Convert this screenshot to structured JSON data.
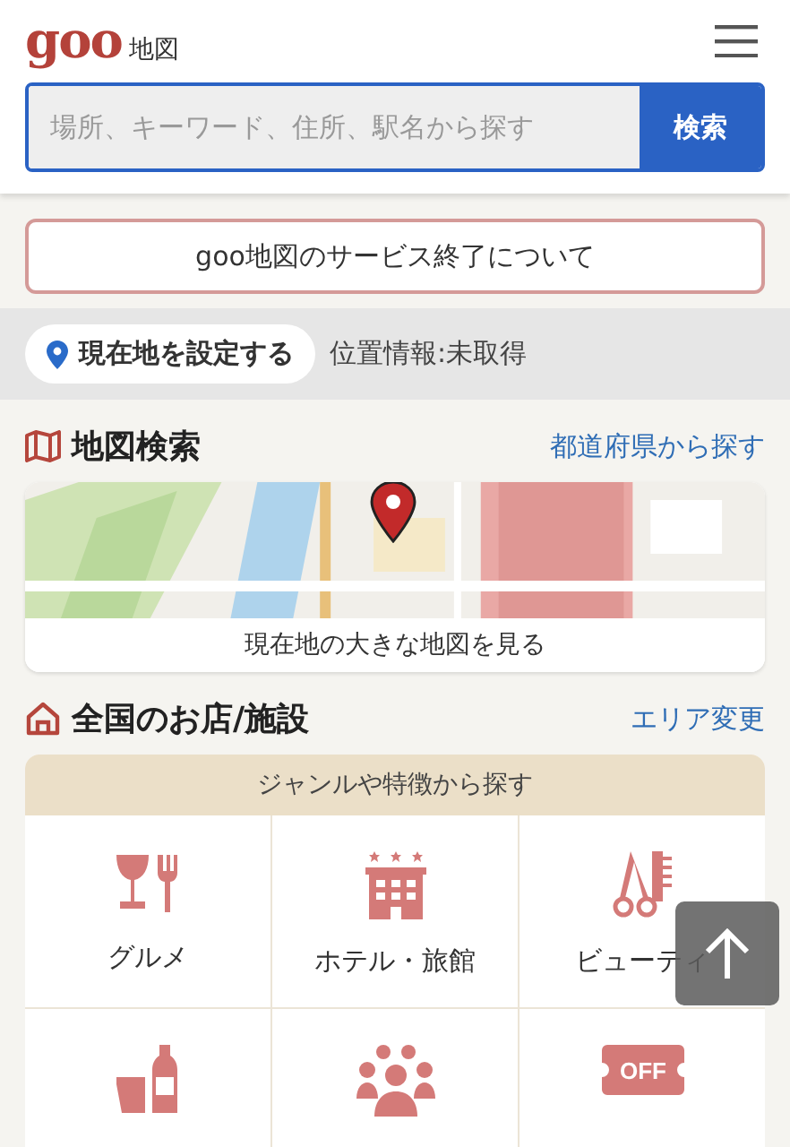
{
  "header": {
    "logo": "goo",
    "logo_sub": "地図"
  },
  "search": {
    "placeholder": "場所、キーワード、住所、駅名から探す",
    "button": "検索"
  },
  "notice": "goo地図のサービス終了について",
  "location": {
    "button": "現在地を設定する",
    "status": "位置情報:未取得"
  },
  "map_section": {
    "title": "地図検索",
    "link": "都道府県から探す",
    "map_button": "現在地の大きな地図を見る"
  },
  "shop_section": {
    "title": "全国のお店/施設",
    "link": "エリア変更",
    "genre_header": "ジャンルや特徴から探す",
    "genres": [
      {
        "kind": "gourmet",
        "label": "グルメ"
      },
      {
        "kind": "hotel",
        "label": "ホテル・旅館"
      },
      {
        "kind": "beauty",
        "label": "ビューティ"
      },
      {
        "kind": "drinks"
      },
      {
        "kind": "people"
      },
      {
        "kind": "coupon",
        "badge": "OFF"
      }
    ]
  }
}
